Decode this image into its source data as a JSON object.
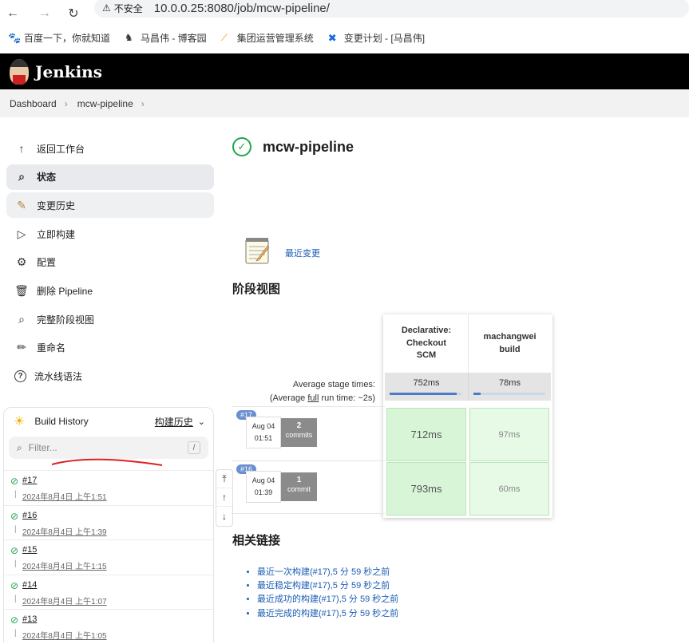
{
  "browser": {
    "security": "不安全",
    "url": "10.0.0.25:8080/job/mcw-pipeline/",
    "bookmarks": [
      "百度一下，你就知道",
      "马昌伟 - 博客园",
      "集团运营管理系统",
      "变更计划 - [马昌伟]"
    ]
  },
  "header": {
    "title": "Jenkins"
  },
  "breadcrumb": [
    "Dashboard",
    "mcw-pipeline"
  ],
  "sidebar": {
    "items": [
      {
        "label": "返回工作台",
        "icon": "arrow-up-icon"
      },
      {
        "label": "状态",
        "icon": "search-icon"
      },
      {
        "label": "变更历史",
        "icon": "notepad-icon"
      },
      {
        "label": "立即构建",
        "icon": "play-icon"
      },
      {
        "label": "配置",
        "icon": "gear-icon"
      },
      {
        "label": "删除 Pipeline",
        "icon": "trash-icon"
      },
      {
        "label": "完整阶段视图",
        "icon": "search-icon"
      },
      {
        "label": "重命名",
        "icon": "pencil-icon"
      },
      {
        "label": "流水线语法",
        "icon": "help-icon"
      }
    ]
  },
  "build_history": {
    "title": "Build History",
    "trend": "构建历史",
    "filter_placeholder": "Filter...",
    "filter_key": "/",
    "builds": [
      {
        "num": "#17",
        "date": "2024年8月4日 上午1:51"
      },
      {
        "num": "#16",
        "date": "2024年8月4日 上午1:39"
      },
      {
        "num": "#15",
        "date": "2024年8月4日 上午1:15"
      },
      {
        "num": "#14",
        "date": "2024年8月4日 上午1:07"
      },
      {
        "num": "#13",
        "date": "2024年8月4日 上午1:05"
      }
    ]
  },
  "main": {
    "title": "mcw-pipeline",
    "recent_changes": "最近变更",
    "stage_view_title": "阶段视图",
    "avg_stage_label": "Average stage times:",
    "avg_run_prefix": "(Average ",
    "avg_run_link": "full",
    "avg_run_suffix": " run time: ~2s)",
    "stages": [
      {
        "name_lines": [
          "Declarative:",
          "Checkout",
          "SCM"
        ],
        "avg": "752ms",
        "avg_fraction": 0.93
      },
      {
        "name_lines": [
          "machangwei",
          "build"
        ],
        "avg": "78ms",
        "avg_fraction": 0.1
      }
    ],
    "runs": [
      {
        "tag": "#17",
        "month": "Aug 04",
        "time": "01:51",
        "commits_n": "2",
        "commits_label": "commits",
        "durations": [
          "712ms",
          "97ms"
        ]
      },
      {
        "tag": "#16",
        "month": "Aug 04",
        "time": "01:39",
        "commits_n": "1",
        "commits_label": "commit",
        "durations": [
          "793ms",
          "60ms"
        ]
      }
    ],
    "links_title": "相关链接",
    "links": [
      "最近一次构建(#17),5 分 59 秒之前",
      "最近稳定构建(#17),5 分 59 秒之前",
      "最近成功的构建(#17),5 分 59 秒之前",
      "最近完成的构建(#17),5 分 59 秒之前"
    ]
  },
  "colors": {
    "success": "#1ea64b",
    "link": "#1b5db4",
    "header_bg": "#000000"
  }
}
